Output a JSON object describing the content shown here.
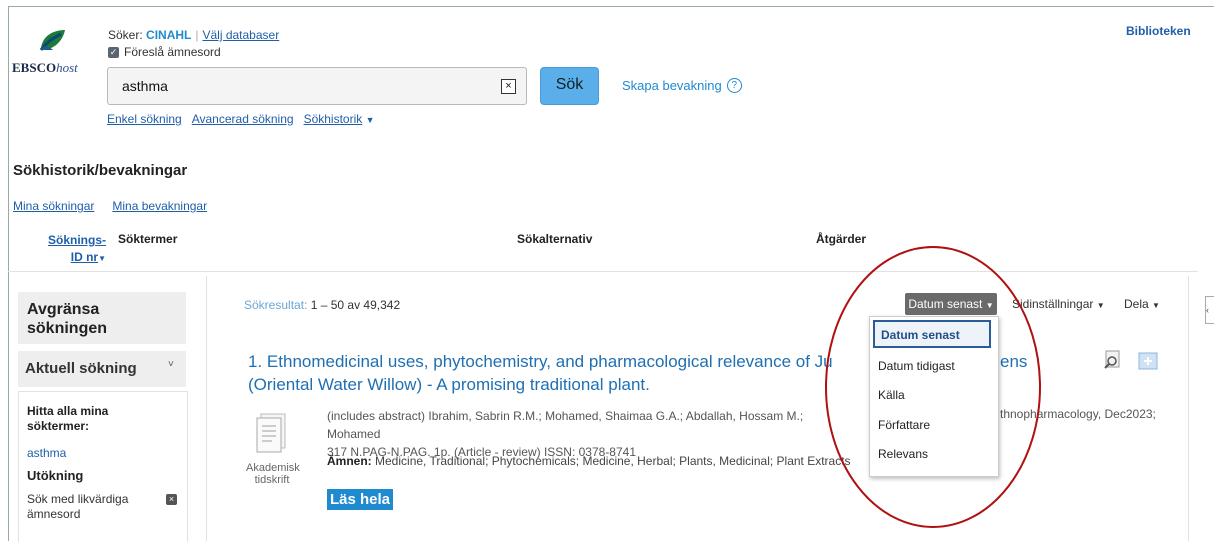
{
  "header": {
    "logo_brand": "EBSCO",
    "logo_suffix": "host",
    "search_label": "Söker:",
    "database": "CINAHL",
    "choose_db": "Välj databaser",
    "suggest_label": "Föreslå ämnesord",
    "search_value": "asthma",
    "search_button": "Sök",
    "create_alert": "Skapa bevakning",
    "libraries": "Biblioteken",
    "nav": [
      "Enkel sökning",
      "Avancerad sökning",
      "Sökhistorik"
    ]
  },
  "history": {
    "title": "Sökhistorik/bevakningar",
    "my_searches": "Mina sökningar",
    "my_alerts": "Mina bevakningar",
    "col_id_line1": "Söknings-",
    "col_id_line2": "ID nr",
    "col_terms": "Söktermer",
    "col_options": "Sökalternativ",
    "col_actions": "Åtgärder"
  },
  "sidebar": {
    "refine_title_1": "Avgränsa",
    "refine_title_2": "sökningen",
    "current_search": "Aktuell sökning",
    "find_all_1": "Hitta alla mina",
    "find_all_2": "söktermer:",
    "term": "asthma",
    "expansion": "Utökning",
    "equiv_1": "Sök med likvärdiga",
    "equiv_2": "ämnesord"
  },
  "results": {
    "count_label": "Sökresultat:",
    "count_value": "1 – 50 av 49,342",
    "sort_button": "Datum senast",
    "page_options": "Sidinställningar",
    "share": "Dela",
    "sort_options": [
      "Datum senast",
      "Datum tidigast",
      "Källa",
      "Författare",
      "Relevans"
    ],
    "item": {
      "number": "1.",
      "title_a": "Ethnomedicinal uses, phytochemistry, and pharmacological relevance of Ju",
      "title_a_tail": "ens",
      "title_b": "(Oriental Water Willow) - A promising traditional plant.",
      "meta_a": "(includes abstract) Ibrahim, Sabrin R.M.; Mohamed, Shaimaa G.A.; Abdallah, Hossam M.; Mohamed",
      "meta_tail": "thnopharmacology, Dec2023;",
      "meta_b": "317 N.PAG-N.PAG. 1p. (Article - review) ISSN: 0378-8741",
      "subjects_label": "Ämnen:",
      "subjects": "Medicine, Traditional; Phytochemicals; Medicine, Herbal; Plants, Medicinal; Plant Extracts",
      "type_1": "Akademisk",
      "type_2": "tidskrift",
      "read_full": "Läs hela"
    }
  },
  "colors": {
    "link": "#1f5ea8",
    "accent": "#1f8ad0",
    "search_button": "#5aaee9",
    "annotation": "#b01010"
  }
}
